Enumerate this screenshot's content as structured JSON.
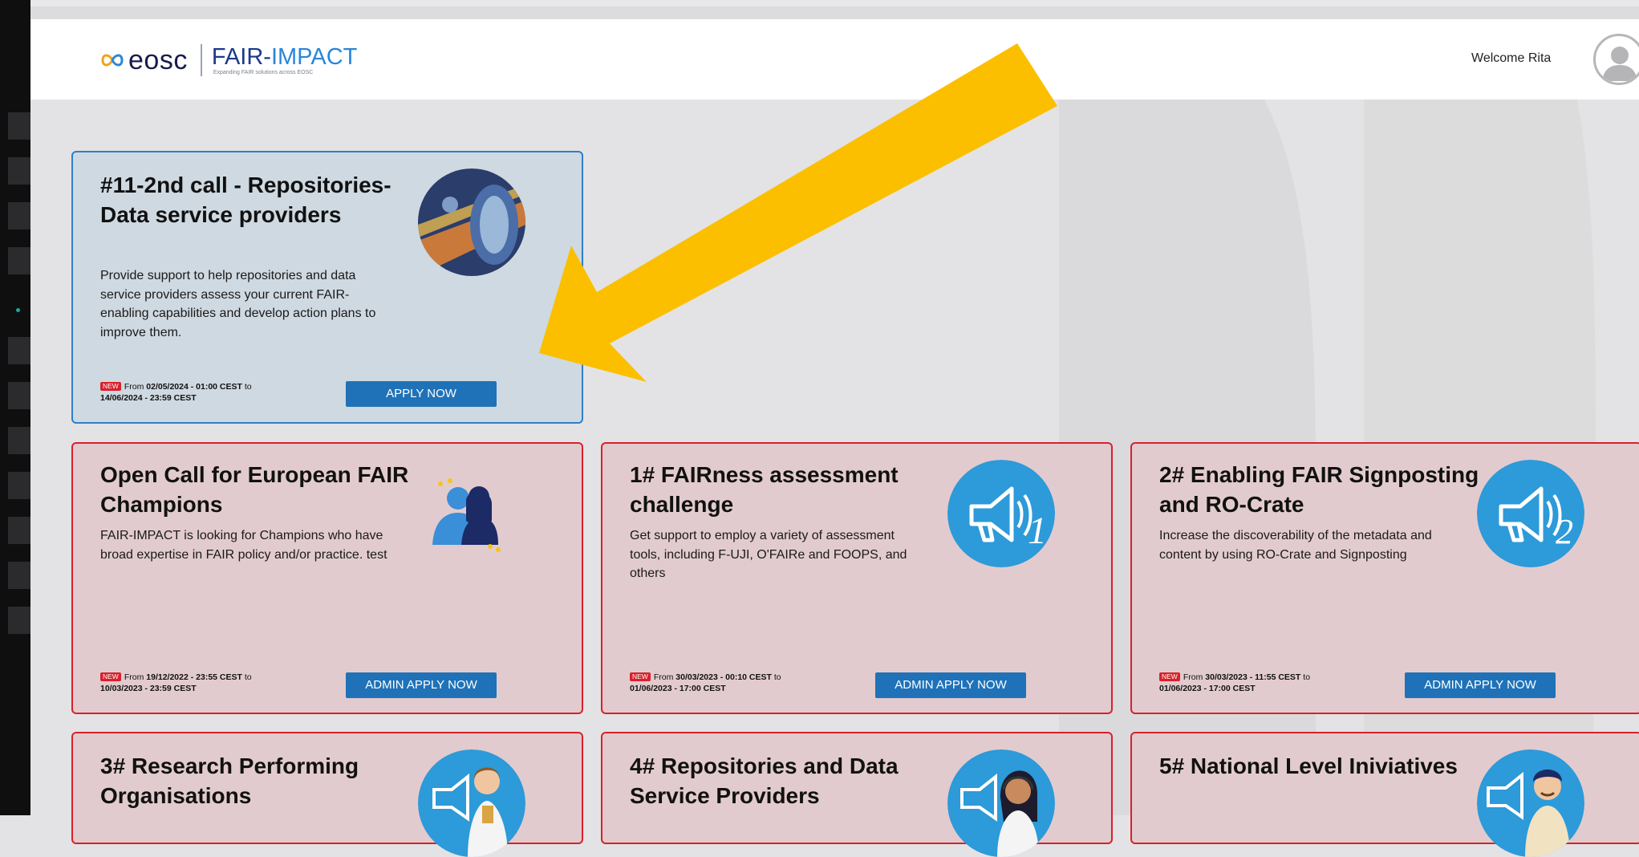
{
  "header": {
    "logo_eosc": "eosc",
    "logo_fair": "FAIR-",
    "logo_impact": "IMPACT",
    "logo_tagline": "Expanding FAIR solutions across EOSC",
    "welcome": "Welcome Rita"
  },
  "colors": {
    "card_border_red": "#d8212b",
    "card_border_blue": "#2f7fc6",
    "button_blue": "#1f72b8",
    "new_badge": "#d8212b",
    "arrow_yellow": "#fbbf00"
  },
  "cards": [
    {
      "title": "#11-2nd call - Repositories-Data service providers",
      "description": "Provide support to help repositories and data service providers assess your current FAIR-enabling capabilities and develop action plans to improve them.",
      "badge": "NEW",
      "from": "From",
      "start": "02/05/2024 - 01:00 CEST",
      "to": "to",
      "end": "14/06/2024 - 23:59 CEST",
      "button": "APPLY NOW",
      "icon": "data-center-photo-icon"
    },
    {
      "title": "Open Call for European FAIR Champions",
      "description": "FAIR-IMPACT is looking for Champions who have broad expertise in FAIR policy and/or practice. test",
      "badge": "NEW",
      "from": "From",
      "start": "19/12/2022 - 23:55 CEST",
      "to": "to",
      "end": "10/03/2023 - 23:59 CEST",
      "button": "ADMIN APPLY NOW",
      "icon": "champions-people-icon"
    },
    {
      "title": "1# FAIRness assessment challenge",
      "description": "Get support to employ a variety of assessment tools, including F-UJI, O'FAIRe and FOOPS, and others",
      "badge": "NEW",
      "from": "From",
      "start": "30/03/2023 - 00:10 CEST",
      "to": "to",
      "end": "01/06/2023 - 17:00 CEST",
      "button": "ADMIN APPLY NOW",
      "icon": "megaphone-1-icon",
      "icon_number": "1"
    },
    {
      "title": "2# Enabling FAIR Signposting and RO-Crate",
      "description": "Increase the discoverability of the metadata and content by using RO-Crate and Signposting",
      "badge": "NEW",
      "from": "From",
      "start": "30/03/2023 - 11:55 CEST",
      "to": "to",
      "end": "01/06/2023 - 17:00 CEST",
      "button": "ADMIN APPLY NOW",
      "icon": "megaphone-2-icon",
      "icon_number": "2"
    },
    {
      "title": "3# Research Performing Organisations",
      "icon": "megaphone-researcher-icon"
    },
    {
      "title": "4# Repositories and Data Service Providers",
      "icon": "megaphone-support-agent-icon"
    },
    {
      "title": "5# National Level Iniviatives",
      "icon": "megaphone-man-icon"
    }
  ]
}
